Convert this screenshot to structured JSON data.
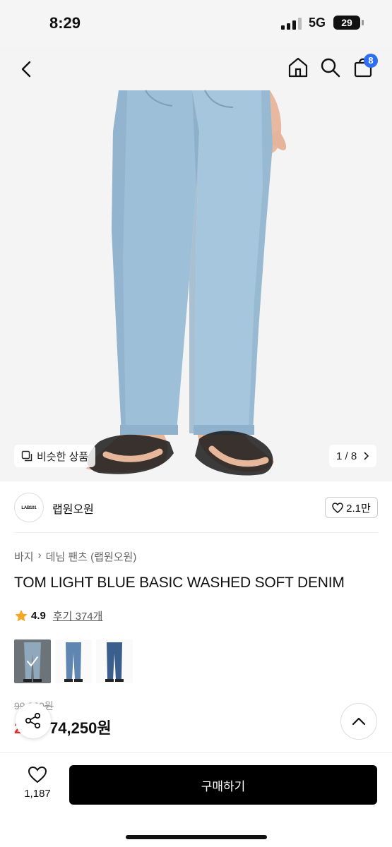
{
  "status_bar": {
    "time": "8:29",
    "network": "5G",
    "battery": "29"
  },
  "header": {
    "cart_count": "8"
  },
  "hero": {
    "similar_label": "비슷한 상품",
    "page_indicator": "1 / 8"
  },
  "brand": {
    "logo_text": "LAB101",
    "name": "랩원오원",
    "likes": "2.1만"
  },
  "breadcrumb": [
    "바지",
    "데님 팬츠 (랩원오원)"
  ],
  "product": {
    "title": "TOM LIGHT BLUE BASIC WASHED SOFT DENIM",
    "rating": "4.9",
    "review_link": "후기 374개",
    "original_price": "99,000원",
    "discount": "25%",
    "price": "74,250원"
  },
  "thumbnails": [
    {
      "name": "light-blue",
      "color": "#8fb5d4"
    },
    {
      "name": "mid-blue",
      "color": "#5f86b0"
    },
    {
      "name": "dark-blue",
      "color": "#3a5f8c"
    }
  ],
  "bottom": {
    "wish_count": "1,187",
    "buy_label": "구매하기"
  },
  "colors": {
    "accent": "#2c6ff0",
    "discount": "#e8332a",
    "star": "#f5a623"
  }
}
